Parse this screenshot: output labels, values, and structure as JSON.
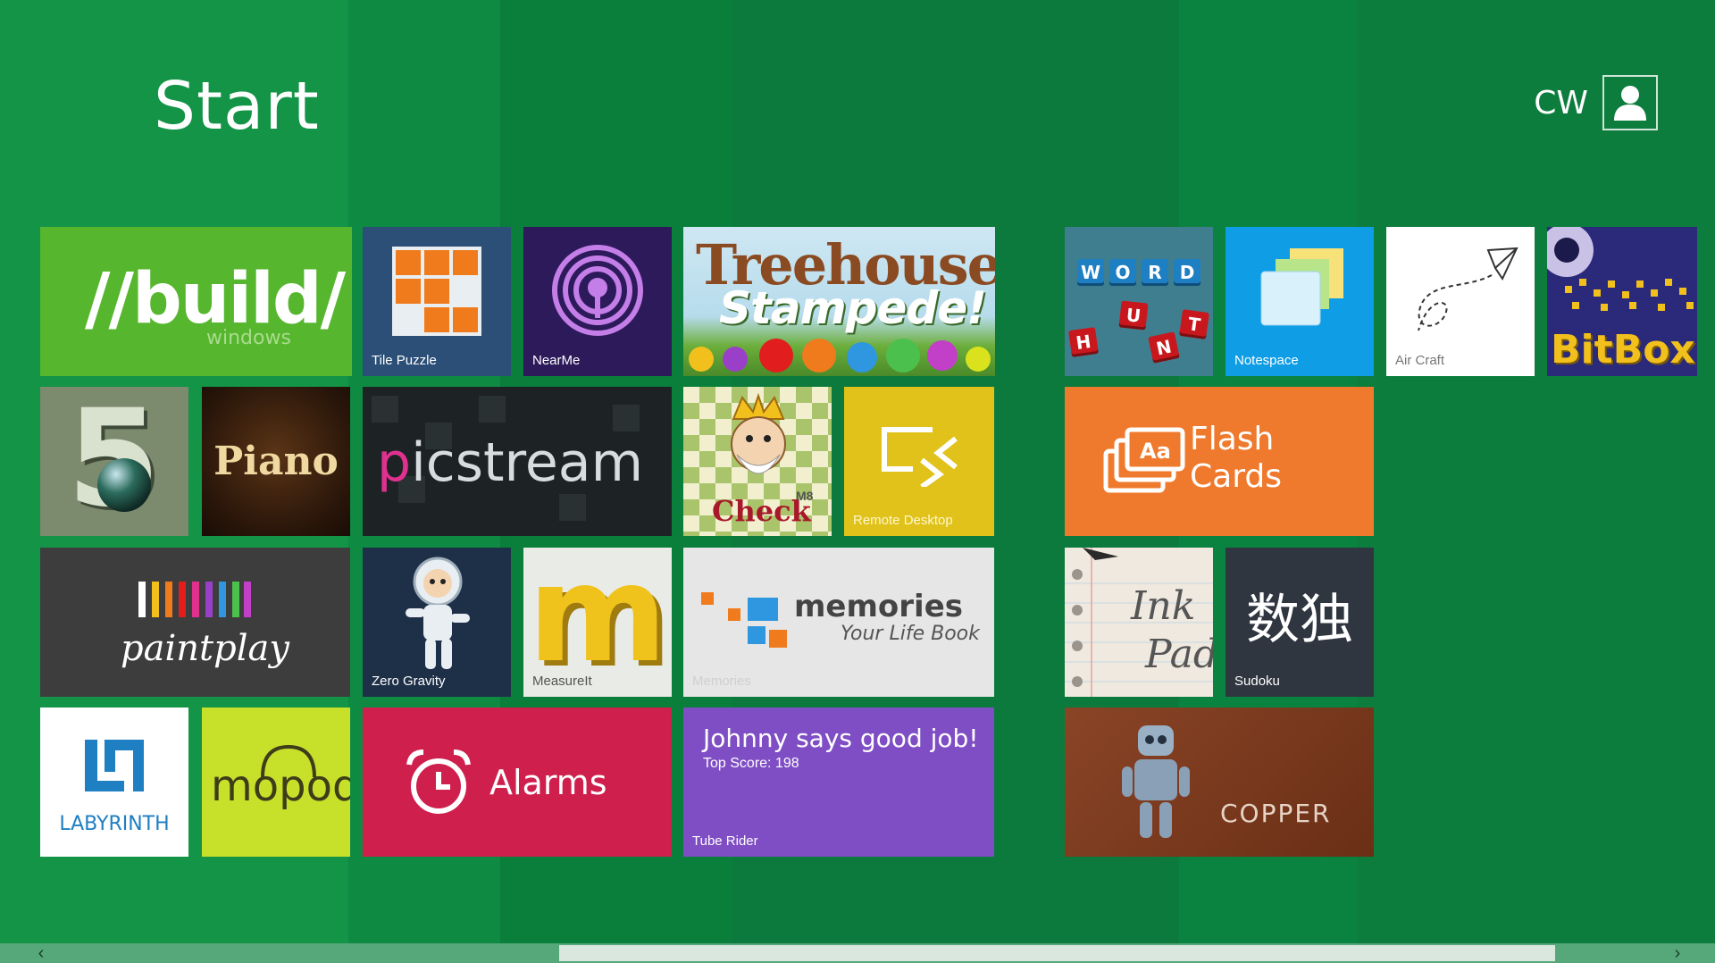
{
  "screen": {
    "title": "Start",
    "user_name": "CW"
  },
  "colors": {
    "background": "#0c7a3c",
    "build": "#56b62e",
    "alarms": "#cf1f4c",
    "flash_cards": "#ef7a2d",
    "remote_desktop": "#e0c21a",
    "tube_rider": "#7f4ec4",
    "notespace": "#0f9de6",
    "copper": "#7a3a1e",
    "mopod": "#c7e12a"
  },
  "tiles": {
    "build": {
      "main": "//build/",
      "sub": "windows"
    },
    "tile_puzzle": {
      "label": "Tile Puzzle",
      "icon": "tile-puzzle-icon"
    },
    "nearme": {
      "label": "NearMe",
      "icon": "broadcast-icon"
    },
    "treehouse": {
      "line1": "Treehouse",
      "line2": "Stampede!"
    },
    "five": {
      "glyph": "5"
    },
    "piano": {
      "text": "Piano"
    },
    "picstream": {
      "accent": "p",
      "rest": "icstream"
    },
    "checkm8": {
      "text": "Check",
      "suffix": "M8"
    },
    "remote_desktop": {
      "label": "Remote Desktop",
      "icon": "remote-desktop-icon"
    },
    "paintplay": {
      "text": "paintplay"
    },
    "zero_gravity": {
      "label": "Zero Gravity",
      "icon": "astronaut-icon"
    },
    "measureit": {
      "label": "MeasureIt",
      "glyph": "m"
    },
    "memories": {
      "title": "memories",
      "subtitle": "Your Life Book",
      "label": "Memories"
    },
    "labyrinth": {
      "text": "LABYRINTH",
      "icon": "labyrinth-icon"
    },
    "mopod": {
      "text": "mopod",
      "icon": "headphones-icon"
    },
    "alarms": {
      "label": "Alarms",
      "icon": "alarm-clock-icon"
    },
    "tube_rider": {
      "headline": "Johnny says good job!",
      "score": "Top Score: 198",
      "label": "Tube Rider"
    },
    "word_hunt": {
      "letters": [
        "W",
        "O",
        "R",
        "D",
        "H",
        "U",
        "N",
        "T"
      ]
    },
    "notespace": {
      "label": "Notespace",
      "icon": "sticky-notes-icon"
    },
    "air_craft": {
      "label": "Air Craft",
      "icon": "paper-plane-icon"
    },
    "bitbox": {
      "text": "BitBox"
    },
    "flash_cards": {
      "line1": "Flash",
      "line2": "Cards",
      "icon": "flash-cards-icon"
    },
    "ink_pad": {
      "line1": "Ink",
      "line2": "Pad"
    },
    "sudoku": {
      "glyphs": "数独",
      "label": "Sudoku"
    },
    "copper": {
      "text": "COPPER",
      "icon": "robot-icon"
    }
  },
  "scrollbar": {
    "left_arrow": "‹",
    "right_arrow": "›"
  }
}
